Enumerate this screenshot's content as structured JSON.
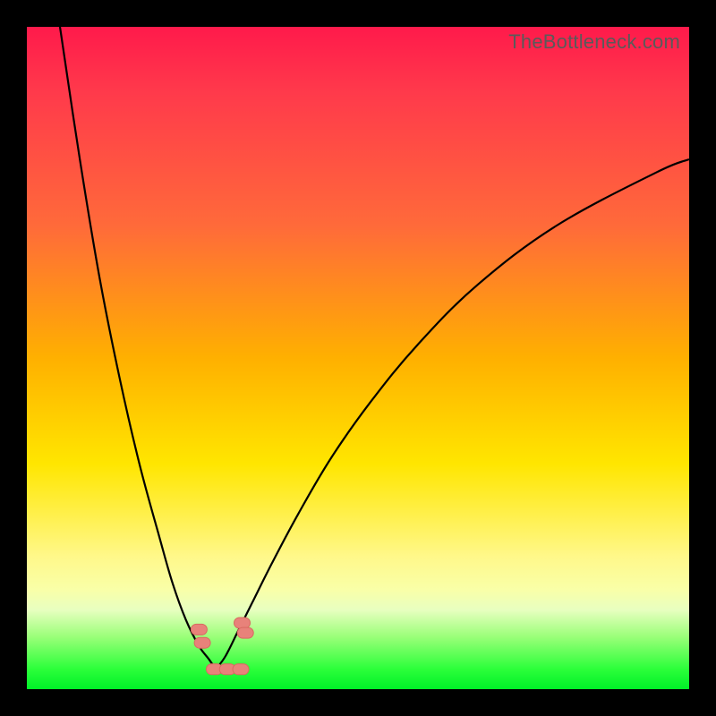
{
  "watermark": "TheBottleneck.com",
  "colors": {
    "background": "#000000",
    "gradient_top": "#ff1a4b",
    "gradient_mid1": "#ff6a3a",
    "gradient_mid2": "#ffe600",
    "gradient_bottom": "#00f028",
    "curve_stroke": "#000000",
    "marker_fill": "#e8827a"
  },
  "chart_data": {
    "type": "line",
    "title": "",
    "xlabel": "",
    "ylabel": "",
    "xlim": [
      0,
      100
    ],
    "ylim": [
      0,
      100
    ],
    "note": "y-axis is inverted relative to canvas: 0 = top (worst/red), 100 = bottom (best/green). Curves estimated from pixel readout.",
    "series": [
      {
        "name": "curve_left",
        "x": [
          5,
          8,
          11,
          14,
          17,
          20,
          22,
          24,
          26,
          27.5,
          28.5
        ],
        "y": [
          0,
          20,
          38,
          53,
          66,
          77,
          84,
          89.5,
          93.5,
          95.5,
          97
        ]
      },
      {
        "name": "curve_right",
        "x": [
          28.5,
          30,
          32,
          34,
          37,
          41,
          46,
          52,
          59,
          68,
          80,
          95,
          100
        ],
        "y": [
          97,
          95,
          91,
          87,
          81,
          73.5,
          65,
          56.5,
          48,
          39,
          30,
          22,
          20
        ]
      }
    ],
    "markers": [
      {
        "name": "left_cluster_top",
        "x": 26.0,
        "y": 91.0
      },
      {
        "name": "left_cluster_bottom",
        "x": 26.5,
        "y": 93.0
      },
      {
        "name": "right_cluster_a",
        "x": 32.5,
        "y": 90.0
      },
      {
        "name": "right_cluster_b",
        "x": 33.0,
        "y": 91.5
      },
      {
        "name": "floor_left",
        "x": 28.3,
        "y": 97.0
      },
      {
        "name": "floor_mid",
        "x": 30.3,
        "y": 97.0
      },
      {
        "name": "floor_right",
        "x": 32.3,
        "y": 97.0
      }
    ]
  }
}
